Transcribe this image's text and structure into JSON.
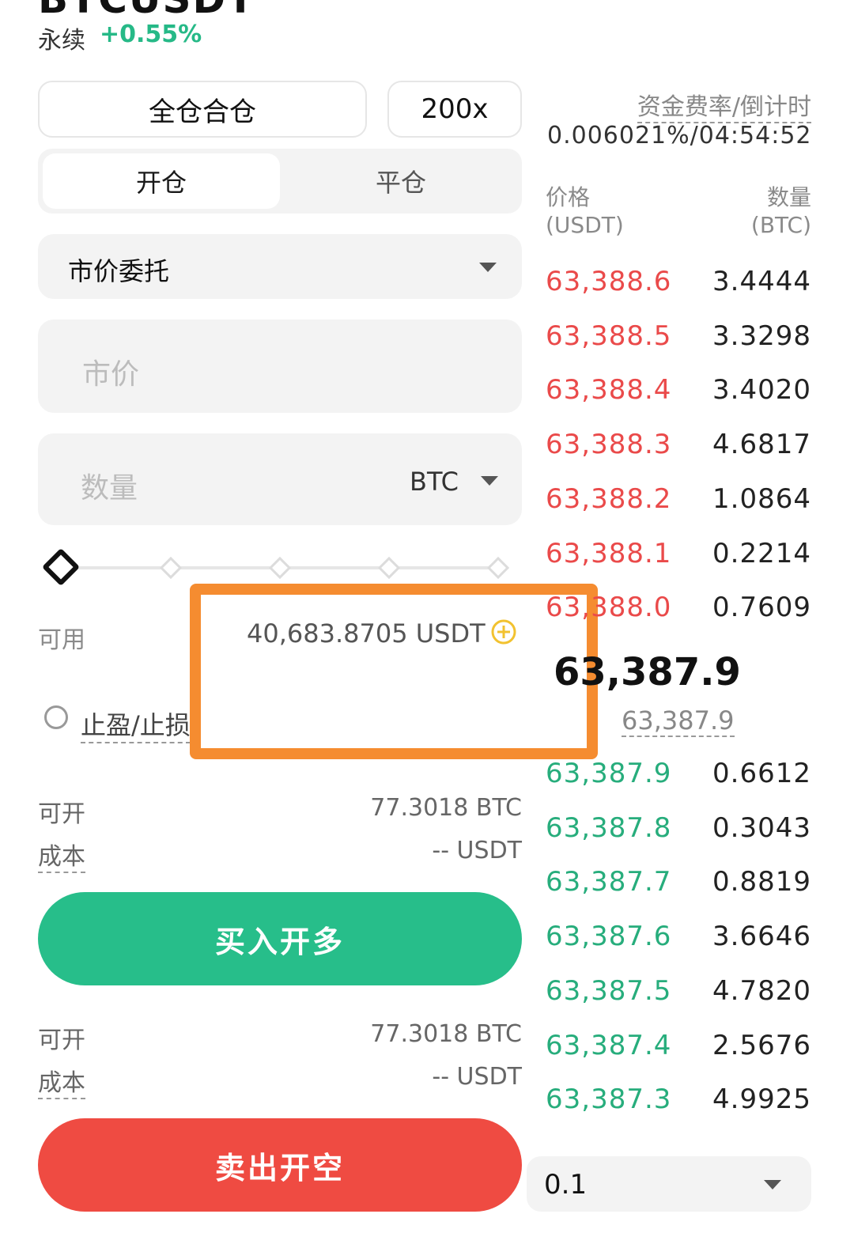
{
  "header": {
    "symbol": "BTCUSDT",
    "contract_type": "永续",
    "change": "+0.55%"
  },
  "margin_mode": {
    "label": "全仓合仓"
  },
  "leverage": {
    "label": "200x"
  },
  "position_tabs": {
    "open": "开仓",
    "close": "平仓"
  },
  "order_type": {
    "label": "市价委托"
  },
  "price_field": {
    "placeholder": "市价"
  },
  "quantity_field": {
    "placeholder": "数量",
    "unit": "BTC"
  },
  "slider": {
    "level": 0
  },
  "available": {
    "label": "可用",
    "value": "40,683.8705 USDT"
  },
  "tpsl": {
    "label": "止盈/止损"
  },
  "long_info": {
    "max_label": "可开",
    "max_value": "77.3018 BTC",
    "cost_label": "成本",
    "cost_value": "-- USDT"
  },
  "buy_button": {
    "label": "买入开多"
  },
  "short_info": {
    "max_label": "可开",
    "max_value": "77.3018 BTC",
    "cost_label": "成本",
    "cost_value": "-- USDT"
  },
  "sell_button": {
    "label": "卖出开空"
  },
  "funding": {
    "label": "资金费率/倒计时",
    "value": "0.006021%/04:54:52"
  },
  "orderbook": {
    "price_header": "价格",
    "price_unit": "(USDT)",
    "qty_header": "数量",
    "qty_unit": "(BTC)",
    "asks": [
      {
        "price": "63,388.6",
        "qty": "3.4444",
        "depth": 0.92
      },
      {
        "price": "63,388.5",
        "qty": "3.3298",
        "depth": 0.9
      },
      {
        "price": "63,388.4",
        "qty": "3.4020",
        "depth": 0.8
      },
      {
        "price": "63,388.3",
        "qty": "4.6817",
        "depth": 0.7
      },
      {
        "price": "63,388.2",
        "qty": "1.0864",
        "depth": 0.55
      },
      {
        "price": "63,388.1",
        "qty": "0.2214",
        "depth": 0.3
      },
      {
        "price": "63,388.0",
        "qty": "0.7609",
        "depth": 0.08
      }
    ],
    "last_price": "63,387.9",
    "mark_price": "63,387.9",
    "bids": [
      {
        "price": "63,387.9",
        "qty": "0.6612",
        "depth": 0.1
      },
      {
        "price": "63,387.8",
        "qty": "0.3043",
        "depth": 0.25
      },
      {
        "price": "63,387.7",
        "qty": "0.8819",
        "depth": 0.4
      },
      {
        "price": "63,387.6",
        "qty": "3.6646",
        "depth": 0.55
      },
      {
        "price": "63,387.5",
        "qty": "4.7820",
        "depth": 0.75
      },
      {
        "price": "63,387.4",
        "qty": "2.5676",
        "depth": 0.9
      },
      {
        "price": "63,387.3",
        "qty": "4.9925",
        "depth": 1.0
      }
    ],
    "precision": "0.1"
  },
  "colors": {
    "green": "#27be8a",
    "red": "#ef4b42",
    "highlight": "#f58c30",
    "plus_icon": "#f2c230"
  }
}
